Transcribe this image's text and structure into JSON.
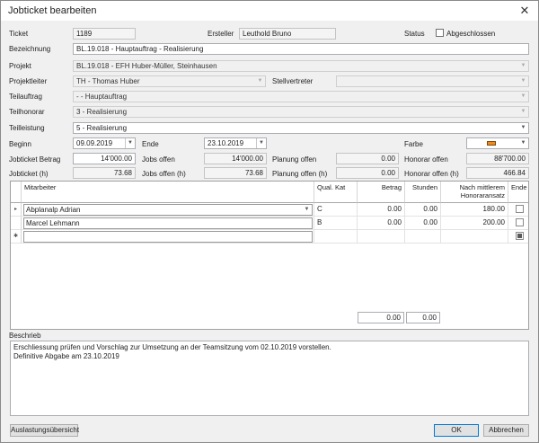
{
  "window": {
    "title": "Jobticket bearbeiten",
    "close_glyph": "✕"
  },
  "ticket": {
    "label": "Ticket",
    "value": "1189"
  },
  "ersteller": {
    "label": "Ersteller",
    "value": "Leuthold Bruno"
  },
  "status": {
    "label": "Status",
    "checkbox_label": "Abgeschlossen",
    "checked": false
  },
  "bezeichnung": {
    "label": "Bezeichnung",
    "value": "BL.19.018 - Hauptauftrag - Realisierung"
  },
  "projekt": {
    "label": "Projekt",
    "value": "BL.19.018 - EFH Huber-Müller, Steinhausen"
  },
  "projektleiter": {
    "label": "Projektleiter",
    "value": "TH - Thomas Huber"
  },
  "stellvertreter": {
    "label": "Stellvertreter",
    "value": ""
  },
  "teilauftrag": {
    "label": "Teilauftrag",
    "value": "- - Hauptauftrag"
  },
  "teilhonorar": {
    "label": "Teilhonorar",
    "value": "3 - Realisierung"
  },
  "teilleistung": {
    "label": "Teilleistung",
    "value": "5 - Realisierung"
  },
  "beginn": {
    "label": "Beginn",
    "value": "09.09.2019"
  },
  "ende": {
    "label": "Ende",
    "value": "23.10.2019"
  },
  "farbe": {
    "label": "Farbe",
    "color": "#f08a1a"
  },
  "jobticket_betrag": {
    "label": "Jobticket Betrag",
    "value": "14'000.00"
  },
  "jobs_offen": {
    "label": "Jobs offen",
    "value": "14'000.00"
  },
  "planung_offen": {
    "label": "Planung offen",
    "value": "0.00"
  },
  "honorar_offen": {
    "label": "Honorar offen",
    "value": "88'700.00"
  },
  "jobticket_h": {
    "label": "Jobticket (h)",
    "value": "73.68"
  },
  "jobs_offen_h": {
    "label": "Jobs offen (h)",
    "value": "73.68"
  },
  "planung_offen_h": {
    "label": "Planung offen (h)",
    "value": "0.00"
  },
  "honorar_offen_h": {
    "label": "Honorar offen (h)",
    "value": "466.84"
  },
  "grid": {
    "headers": {
      "mitarbeiter": "Mitarbeiter",
      "qual_kat": "Qual. Kat",
      "betrag": "Betrag",
      "stunden": "Stunden",
      "honoraransatz": "Nach mittlerem Honoraransatz",
      "ende": "Ende"
    },
    "rows": [
      {
        "indicator": "▸",
        "mitarbeiter": "Abplanalp Adrian",
        "qual": "C",
        "betrag": "0.00",
        "stunden": "0.00",
        "honoraransatz": "180.00",
        "ende": false
      },
      {
        "indicator": "",
        "mitarbeiter": "Marcel Lehmann",
        "qual": "B",
        "betrag": "0.00",
        "stunden": "0.00",
        "honoraransatz": "200.00",
        "ende": false
      },
      {
        "indicator": "✱",
        "mitarbeiter": "",
        "qual": "",
        "betrag": "",
        "stunden": "",
        "honoraransatz": "",
        "ende": true
      }
    ],
    "sum_betrag": "0.00",
    "sum_stunden": "0.00"
  },
  "beschrieb": {
    "label": "Beschrieb",
    "line1": "Erschliessung prüfen und Vorschlag zur Umsetzung an der Teamsitzung vom 02.10.2019 vorstellen.",
    "line2": "Definitive Abgabe am 23.10.2019"
  },
  "buttons": {
    "auslastung": "Auslastungsübersicht",
    "ok": "OK",
    "abbrechen": "Abbrechen"
  },
  "icons": {
    "dropdown": "▼",
    "row_current": "▸",
    "row_new": "✱"
  }
}
